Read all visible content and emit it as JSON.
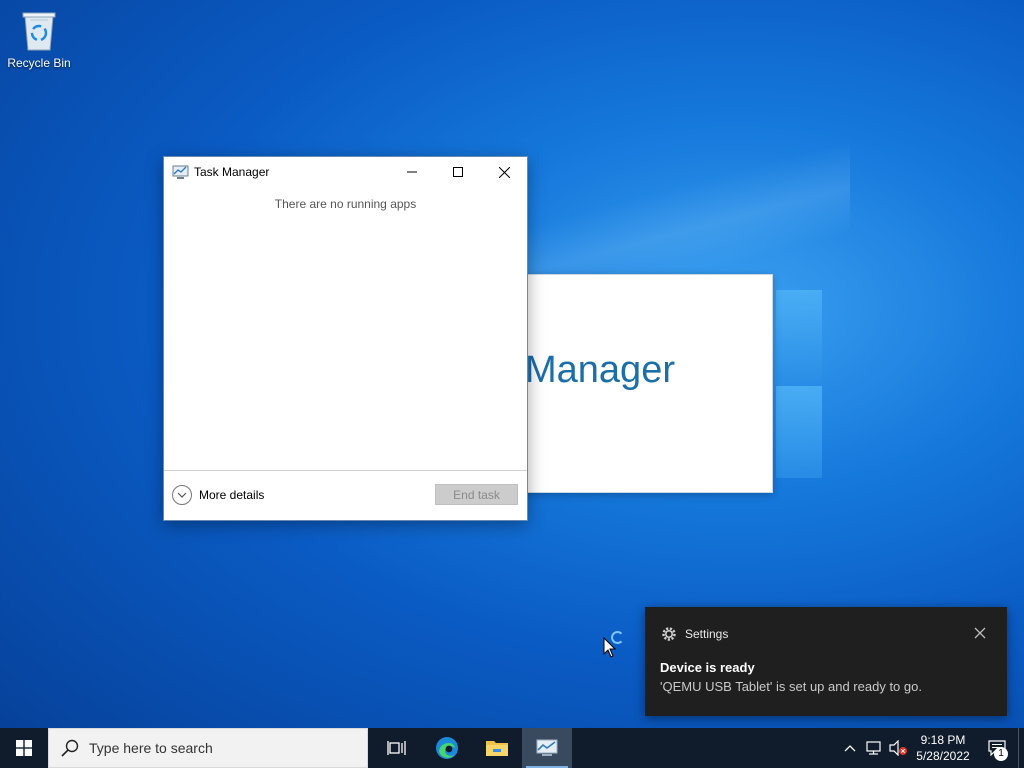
{
  "desktop": {
    "icons": [
      {
        "label": "Recycle Bin",
        "icon": "recycle-bin-icon"
      }
    ]
  },
  "splash": {
    "text": "Manager"
  },
  "task_manager": {
    "title": "Task Manager",
    "empty_message": "There are no running apps",
    "more_details_label": "More details",
    "end_task_label": "End task"
  },
  "toast": {
    "app_name": "Settings",
    "title": "Device is ready",
    "body": "'QEMU USB Tablet' is set up and ready to go."
  },
  "taskbar": {
    "search_placeholder": "Type here to search",
    "apps": [
      {
        "name": "task-view",
        "icon": "task-view-icon"
      },
      {
        "name": "edge",
        "icon": "edge-icon"
      },
      {
        "name": "file-explorer",
        "icon": "folder-icon"
      },
      {
        "name": "task-manager",
        "icon": "task-manager-icon"
      }
    ],
    "clock": {
      "time": "9:18 PM",
      "date": "5/28/2022"
    },
    "notification_count": "1"
  },
  "colors": {
    "accent": "#0078d7",
    "taskbar": "#101c2b",
    "toast_bg": "#1f1f1f"
  }
}
